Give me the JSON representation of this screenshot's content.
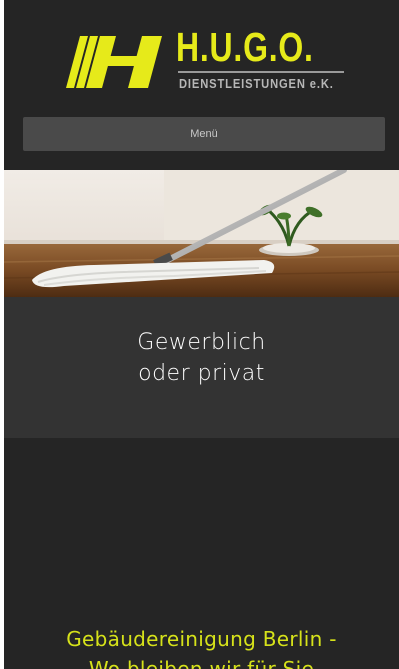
{
  "brand": {
    "name": "H.U.G.O.",
    "subtitle": "DIENSTLEISTUNGEN e.K.",
    "accent_color": "#e6ea1a"
  },
  "nav": {
    "menu_label": "Menü"
  },
  "hero": {
    "image": "floor-mop-photo"
  },
  "intro": {
    "line1": "Gewerblich",
    "line2": "oder privat"
  },
  "tagline": {
    "line1": "Gebäudereinigung Berlin -",
    "line2": "Wo bleiben wir für Sie"
  }
}
